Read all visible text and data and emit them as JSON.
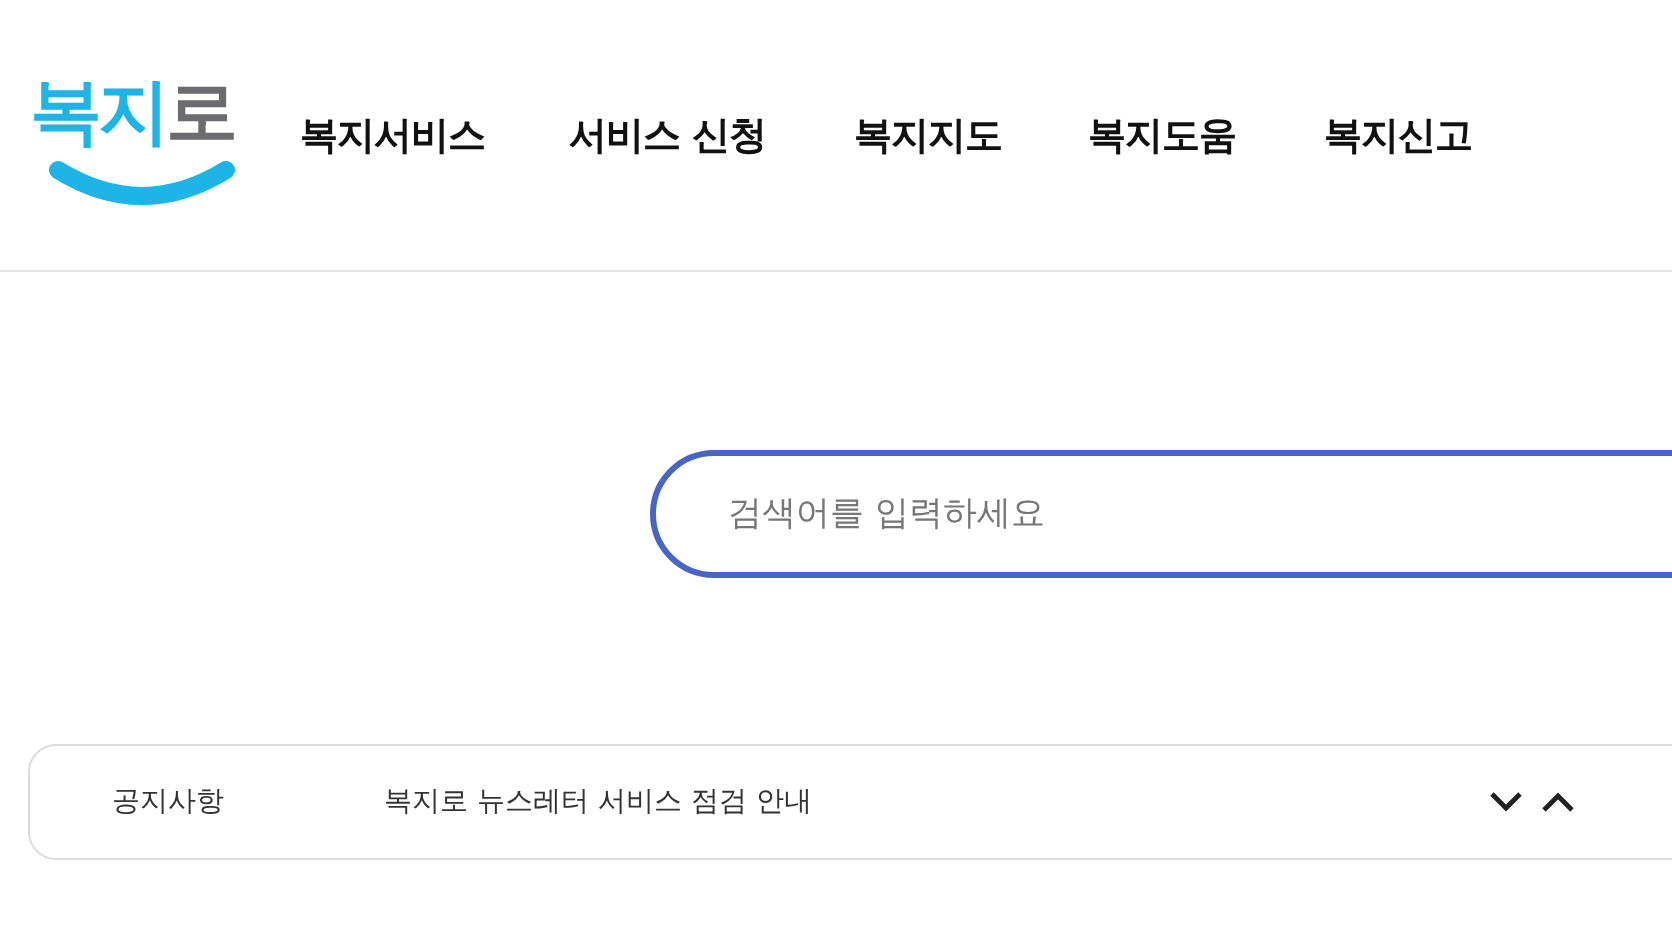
{
  "logo": {
    "text": "복지로"
  },
  "nav": [
    {
      "label": "복지서비스"
    },
    {
      "label": "서비스 신청"
    },
    {
      "label": "복지지도"
    },
    {
      "label": "복지도움"
    },
    {
      "label": "복지신고"
    }
  ],
  "search": {
    "placeholder": "검색어를 입력하세요"
  },
  "notice": {
    "label": "공지사항",
    "text": "복지로 뉴스레터 서비스 점검 안내"
  }
}
